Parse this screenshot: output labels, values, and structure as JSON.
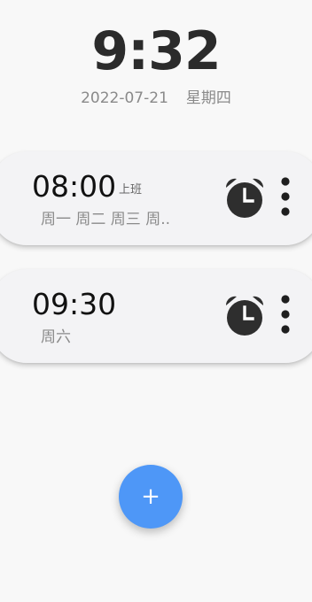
{
  "clock": {
    "time": "9:32",
    "date": "2022-07-21",
    "weekday": "星期四"
  },
  "alarms": [
    {
      "time": "08:00",
      "tag": "上班",
      "days": "周一 周二 周三 周..",
      "icon": "alarm-clock-icon"
    },
    {
      "time": "09:30",
      "tag": "",
      "days": "周六",
      "icon": "alarm-clock-icon"
    }
  ],
  "fab": {
    "label": "+",
    "color": "#4e97f7"
  },
  "colors": {
    "background": "#f8f8f8",
    "card": "#f3f3f5",
    "accent": "#4e97f7"
  }
}
